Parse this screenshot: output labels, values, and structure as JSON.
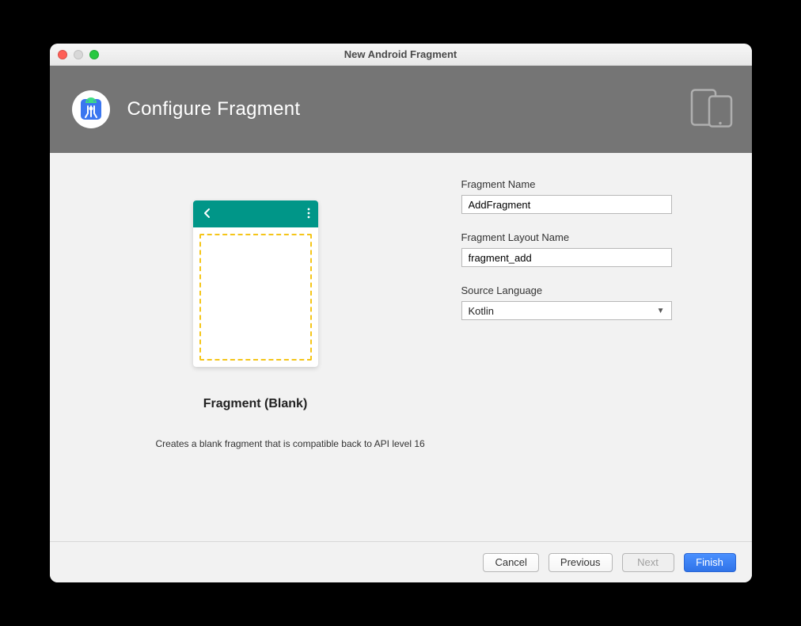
{
  "window": {
    "title": "New Android Fragment"
  },
  "header": {
    "title": "Configure Fragment"
  },
  "preview": {
    "label": "Fragment (Blank)",
    "description": "Creates a blank fragment that is compatible back to API level 16"
  },
  "form": {
    "fragment_name": {
      "label": "Fragment Name",
      "value": "AddFragment"
    },
    "layout_name": {
      "label": "Fragment Layout Name",
      "value": "fragment_add"
    },
    "source_language": {
      "label": "Source Language",
      "value": "Kotlin"
    }
  },
  "buttons": {
    "cancel": "Cancel",
    "previous": "Previous",
    "next": "Next",
    "finish": "Finish"
  }
}
